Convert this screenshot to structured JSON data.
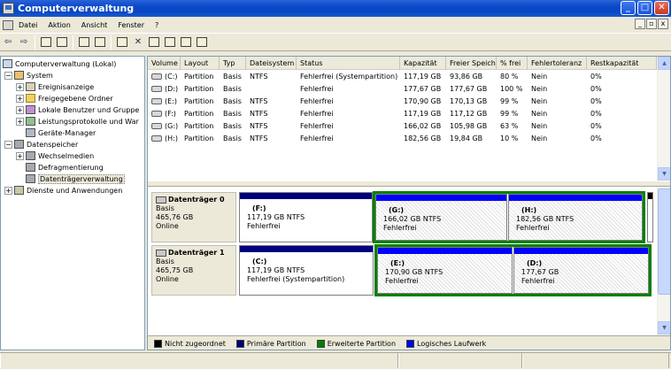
{
  "window": {
    "title": "Computerverwaltung"
  },
  "menu": [
    "Datei",
    "Aktion",
    "Ansicht",
    "Fenster",
    "?"
  ],
  "title_buttons": {
    "minimize": "_",
    "maximize": "□",
    "close": "✕"
  },
  "mdi_buttons": {
    "minimize": "_",
    "restore": "▫",
    "close": "x"
  },
  "toolbar": {
    "back": "⇦",
    "forward": "⇨"
  },
  "tree": [
    {
      "label": "Computerverwaltung (Lokal)",
      "level": 0,
      "expander": "",
      "icon": "pc"
    },
    {
      "label": "System",
      "level": 1,
      "expander": "−",
      "icon": "tool"
    },
    {
      "label": "Ereignisanzeige",
      "level": 2,
      "expander": "+",
      "icon": "book"
    },
    {
      "label": "Freigegebene Ordner",
      "level": 2,
      "expander": "+",
      "icon": "folder"
    },
    {
      "label": "Lokale Benutzer und Gruppe",
      "level": 2,
      "expander": "+",
      "icon": "users"
    },
    {
      "label": "Leistungsprotokolle und War",
      "level": 2,
      "expander": "+",
      "icon": "chart"
    },
    {
      "label": "Geräte-Manager",
      "level": 2,
      "expander": "",
      "icon": "dev"
    },
    {
      "label": "Datenspeicher",
      "level": 1,
      "expander": "−",
      "icon": "disk"
    },
    {
      "label": "Wechselmedien",
      "level": 2,
      "expander": "+",
      "icon": "disk"
    },
    {
      "label": "Defragmentierung",
      "level": 2,
      "expander": "",
      "icon": "disk"
    },
    {
      "label": "Datenträgerverwaltung",
      "level": 2,
      "expander": "",
      "icon": "disk",
      "selected": true
    },
    {
      "label": "Dienste und Anwendungen",
      "level": 1,
      "expander": "+",
      "icon": "svc"
    }
  ],
  "volume_table": {
    "columns": [
      "Volume",
      "Layout",
      "Typ",
      "Dateisystem",
      "Status",
      "Kapazität",
      "Freier Speicher",
      "% frei",
      "Fehlertoleranz",
      "Restkapazität"
    ],
    "rows": [
      [
        "(C:)",
        "Partition",
        "Basis",
        "NTFS",
        "Fehlerfrei (Systempartition)",
        "117,19 GB",
        "93,86 GB",
        "80 %",
        "Nein",
        "0%"
      ],
      [
        "(D:)",
        "Partition",
        "Basis",
        "",
        "Fehlerfrei",
        "177,67 GB",
        "177,67 GB",
        "100 %",
        "Nein",
        "0%"
      ],
      [
        "(E:)",
        "Partition",
        "Basis",
        "NTFS",
        "Fehlerfrei",
        "170,90 GB",
        "170,13 GB",
        "99 %",
        "Nein",
        "0%"
      ],
      [
        "(F:)",
        "Partition",
        "Basis",
        "NTFS",
        "Fehlerfrei",
        "117,19 GB",
        "117,12 GB",
        "99 %",
        "Nein",
        "0%"
      ],
      [
        "(G:)",
        "Partition",
        "Basis",
        "NTFS",
        "Fehlerfrei",
        "166,02 GB",
        "105,98 GB",
        "63 %",
        "Nein",
        "0%"
      ],
      [
        "(H:)",
        "Partition",
        "Basis",
        "NTFS",
        "Fehlerfrei",
        "182,56 GB",
        "19,84 GB",
        "10 %",
        "Nein",
        "0%"
      ]
    ]
  },
  "disks": [
    {
      "name": "Datenträger 0",
      "type": "Basis",
      "size": "465,76 GB",
      "state": "Online",
      "segments": [
        {
          "letter": "(F:)",
          "size": "117,19 GB NTFS",
          "status": "Fehlerfrei",
          "kind": "primary"
        },
        {
          "letter": "(G:)",
          "size": "166,02 GB NTFS",
          "status": "Fehlerfrei",
          "kind": "logical"
        },
        {
          "letter": "(H:)",
          "size": "182,56 GB NTFS",
          "status": "Fehlerfrei",
          "kind": "logical"
        }
      ]
    },
    {
      "name": "Datenträger 1",
      "type": "Basis",
      "size": "465,75 GB",
      "state": "Online",
      "segments": [
        {
          "letter": "(C:)",
          "size": "117,19 GB NTFS",
          "status": "Fehlerfrei (Systempartition)",
          "kind": "primary"
        },
        {
          "letter": "(E:)",
          "size": "170,90 GB NTFS",
          "status": "Fehlerfrei",
          "kind": "logical"
        },
        {
          "letter": "(D:)",
          "size": "177,67 GB",
          "status": "Fehlerfrei",
          "kind": "logical"
        }
      ]
    }
  ],
  "legend": [
    {
      "label": "Nicht zugeordnet",
      "color": "#000000"
    },
    {
      "label": "Primäre Partition",
      "color": "#000080"
    },
    {
      "label": "Erweiterte Partition",
      "color": "#008000"
    },
    {
      "label": "Logisches Laufwerk",
      "color": "#0000ff"
    }
  ],
  "colors": {
    "primary": "#000080",
    "logical": "#0000ff",
    "extended": "#008000",
    "unallocated": "#000000"
  },
  "scrollbar": {
    "up": "▲",
    "down": "▼"
  }
}
